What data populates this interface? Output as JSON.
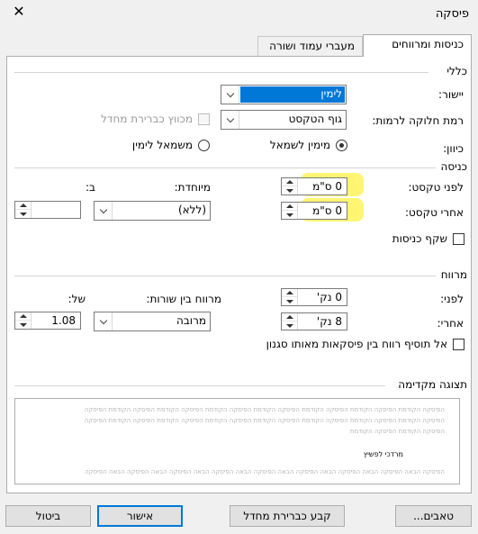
{
  "window": {
    "title": "פיסקה",
    "close_label": "✕"
  },
  "tabs": [
    {
      "label": "כניסות ומרווחים",
      "active": true
    },
    {
      "label": "מעברי עמוד ושורה",
      "active": false
    }
  ],
  "general": {
    "section_label": "כללי",
    "alignment_label": "יישור:",
    "alignment_value": "לימין",
    "outline_label": "רמת חלוקה לרמות:",
    "outline_value": "גוף הטקסט",
    "collapsed_label": "מכווץ כברירת מחדל",
    "direction_label": "כיוון:",
    "rtl_label": "מימין לשמאל",
    "ltr_label": "משמאל לימין"
  },
  "indentation": {
    "section_label": "כניסה",
    "before_label": "לפני טקסט:",
    "before_value": "0 ס\"מ",
    "after_label": "אחרי טקסט:",
    "after_value": "0 ס\"מ",
    "special_label": "מיוחדת:",
    "special_value": "(ללא)",
    "by_label": "ב:",
    "by_value": "",
    "mirror_label": "שקף כניסות"
  },
  "spacing": {
    "section_label": "מרווח",
    "before_label": "לפני:",
    "before_value": "0 נק'",
    "after_label": "אחרי:",
    "after_value": "8 נק'",
    "line_spacing_label": "מרווח בין שורות:",
    "line_spacing_value": "מרובה",
    "at_label": "של:",
    "at_value": "1.08",
    "dont_add_label": "אל תוסיף רווח בין פיסקאות מאותו סגנון"
  },
  "preview": {
    "section_label": "תצוגה מקדימה",
    "prev_line_1": "הפיסקה הקודמת הפיסקה הקודמת הפיסקה הקודמת הפיסקה הקודמת הפיסקה הקודמת הפיסקה הקודמת הפיסקה הקודמת הפיסקה",
    "prev_line_2": "הפיסקה הקודמת הפיסקה הקודמת הפיסקה הקודמת הפיסקה הקודמת הפיסקה הקודמת הפיסקה הקודמת הפיסקה הקודמת הפיסקה",
    "prev_line_3": "הפיסקה הקודמת הפיסקה הקודמת",
    "sample_text": "מרדכי לפשיץ",
    "next_line_1": "הפיסקה הבאה הפיסקה הבאה הפיסקה הבאה הפיסקה הבאה הפיסקה הבאה הפיסקה הבאה הפיסקה הבאה הפיסקה הבאה הפיסקה"
  },
  "buttons": {
    "tabs": "טאבים...",
    "set_default": "קבע כברירת מחדל",
    "ok": "אישור",
    "cancel": "ביטול"
  },
  "colors": {
    "highlight": "#fff35a",
    "selection": "#0078d7"
  }
}
